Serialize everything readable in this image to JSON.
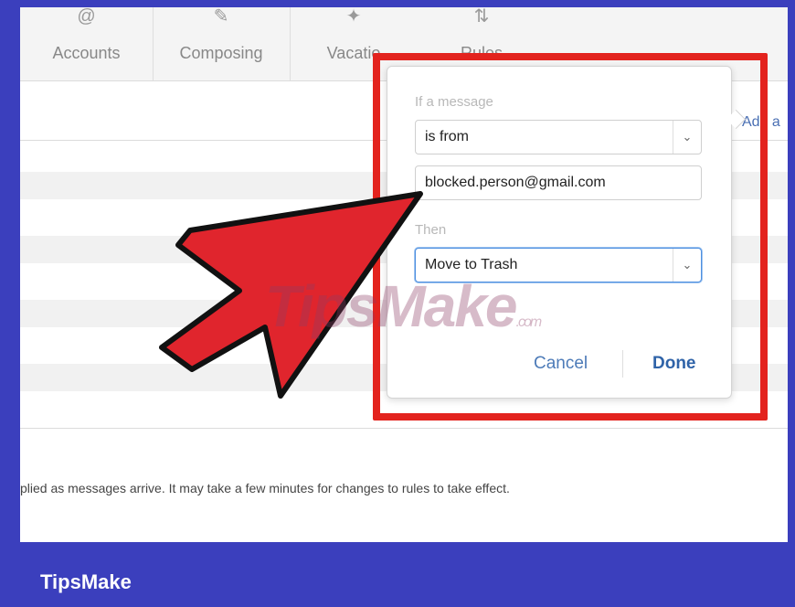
{
  "toolbar": {
    "tabs": [
      {
        "label": "Accounts",
        "icon": "at-icon"
      },
      {
        "label": "Composing",
        "icon": "compose-icon"
      },
      {
        "label": "Vacatio",
        "icon": "plane-icon"
      },
      {
        "label": "Rules",
        "icon": "rules-icon"
      }
    ]
  },
  "main": {
    "add_link": "Add a",
    "footer_note": "plied as messages arrive. It may take a few minutes for changes to rules to take effect."
  },
  "rule_popover": {
    "if_label": "If a message",
    "condition": "is from",
    "value": "blocked.person@gmail.com",
    "then_label": "Then",
    "action": "Move to Trash",
    "cancel_label": "Cancel",
    "done_label": "Done"
  },
  "watermark": {
    "text": "TipsMake",
    "suffix": ".com"
  },
  "brand": {
    "label": "TipsMake"
  },
  "colors": {
    "background": "#3b3fbd",
    "highlight": "#e3231e",
    "arrow": "#e0252d",
    "link": "#4d7bb8"
  }
}
